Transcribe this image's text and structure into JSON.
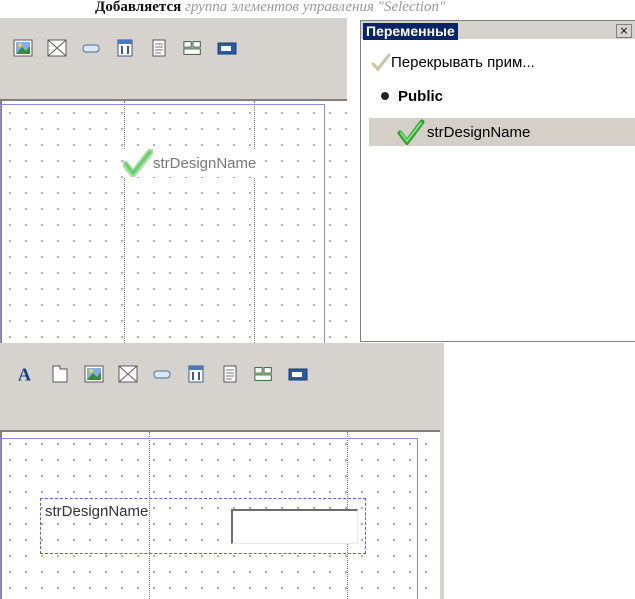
{
  "caption": {
    "bold": "Добавляется",
    "italic": "группа элементов управления \"Selection\""
  },
  "top_form": {
    "check_label": "strDesignName"
  },
  "variables_panel": {
    "title": "Переменные",
    "close_glyph": "×",
    "items": [
      {
        "label": "Перекрывать прим...",
        "icon": "check-icon"
      },
      {
        "label": "Public",
        "icon": "bullet-icon"
      },
      {
        "label": "strDesignName",
        "icon": "check-icon"
      }
    ]
  },
  "bottom_form": {
    "label": "strDesignName",
    "input_value": ""
  },
  "toolbar_icons": [
    "text-icon",
    "frame-icon",
    "picture-icon",
    "image-placeholder-icon",
    "button-icon",
    "calendar-icon",
    "document-icon",
    "group-icon",
    "textbox-icon"
  ],
  "colors": {
    "accent": "#0a246a",
    "guide": "#8a8af5",
    "check": "#3cb83c"
  }
}
